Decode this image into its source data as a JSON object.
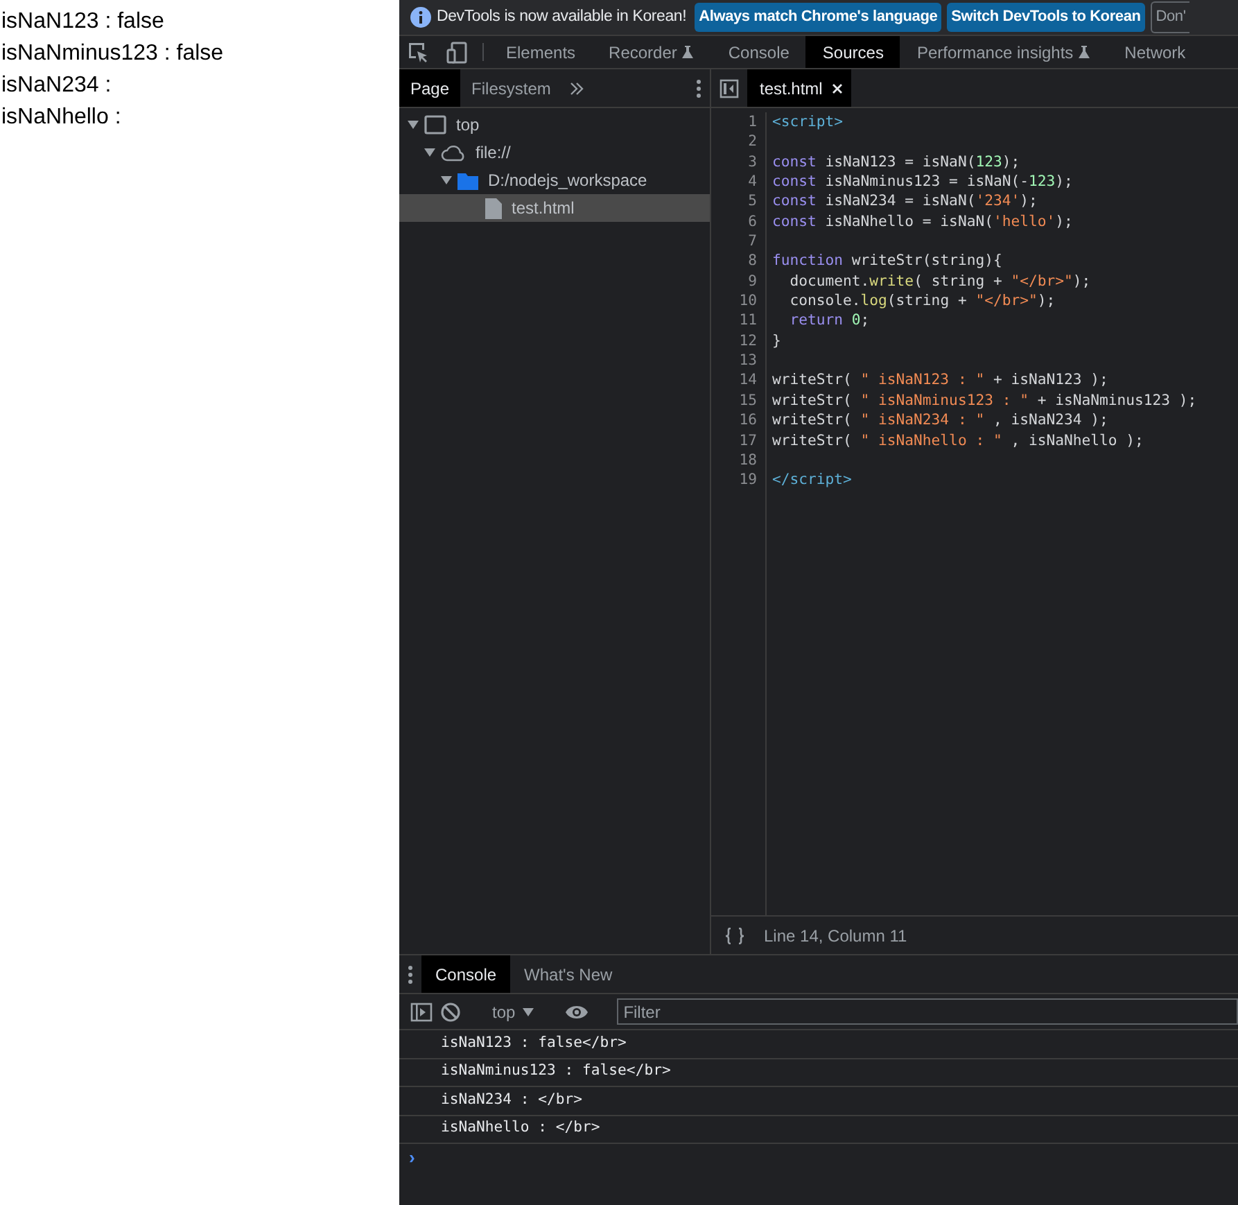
{
  "page_output": [
    "isNaN123 : false",
    "isNaNminus123 : false",
    "isNaN234 :",
    "isNaNhello :"
  ],
  "infobar": {
    "message": "DevTools is now available in Korean!",
    "buttons": [
      {
        "label": "Always match Chrome's language",
        "kind": "primary"
      },
      {
        "label": "Switch DevTools to Korean",
        "kind": "primary"
      },
      {
        "label": "Don'",
        "kind": "outline"
      }
    ]
  },
  "main_tabs": [
    {
      "label": "Elements",
      "selected": false,
      "experimental": false
    },
    {
      "label": "Recorder",
      "selected": false,
      "experimental": true
    },
    {
      "label": "Console",
      "selected": false,
      "experimental": false
    },
    {
      "label": "Sources",
      "selected": true,
      "experimental": false
    },
    {
      "label": "Performance insights",
      "selected": false,
      "experimental": true
    },
    {
      "label": "Network",
      "selected": false,
      "experimental": false
    }
  ],
  "navigator": {
    "tabs": [
      {
        "label": "Page",
        "selected": true
      },
      {
        "label": "Filesystem",
        "selected": false
      }
    ],
    "tree": [
      {
        "label": "top",
        "kind": "frame",
        "selected": false,
        "expanded": true,
        "children": [
          {
            "label": "file://",
            "kind": "origin",
            "selected": false,
            "expanded": true,
            "children": [
              {
                "label": "D:/nodejs_workspace",
                "kind": "folder",
                "selected": false,
                "expanded": true,
                "children": [
                  {
                    "label": "test.html",
                    "kind": "file",
                    "selected": true
                  }
                ]
              }
            ]
          }
        ]
      }
    ]
  },
  "editor": {
    "tabs": [
      {
        "label": "test.html",
        "selected": true
      }
    ],
    "lines": [
      {
        "number": "1",
        "tokens": [
          {
            "kind": "tag",
            "text": "<script>"
          }
        ]
      },
      {
        "number": "2"
      },
      {
        "number": "3",
        "tokens": [
          {
            "kind": "keyword",
            "text": "const"
          },
          {
            "kind": "plain",
            "text": " isNaN123 = isNaN("
          },
          {
            "kind": "number",
            "text": "123"
          },
          {
            "kind": "plain",
            "text": ");"
          }
        ]
      },
      {
        "number": "4",
        "tokens": [
          {
            "kind": "keyword",
            "text": "const"
          },
          {
            "kind": "plain",
            "text": " isNaNminus123 = isNaN(-"
          },
          {
            "kind": "number",
            "text": "123"
          },
          {
            "kind": "plain",
            "text": ");"
          }
        ]
      },
      {
        "number": "5",
        "tokens": [
          {
            "kind": "keyword",
            "text": "const"
          },
          {
            "kind": "plain",
            "text": " isNaN234 = isNaN("
          },
          {
            "kind": "string",
            "text": "'234'"
          },
          {
            "kind": "plain",
            "text": ");"
          }
        ]
      },
      {
        "number": "6",
        "tokens": [
          {
            "kind": "keyword",
            "text": "const"
          },
          {
            "kind": "plain",
            "text": " isNaNhello = isNaN("
          },
          {
            "kind": "string",
            "text": "'hello'"
          },
          {
            "kind": "plain",
            "text": ");"
          }
        ]
      },
      {
        "number": "7"
      },
      {
        "number": "8",
        "tokens": [
          {
            "kind": "keyword",
            "text": "function"
          },
          {
            "kind": "plain",
            "text": " writeStr(string){"
          }
        ]
      },
      {
        "number": "9",
        "tokens": [
          {
            "kind": "plain",
            "text": "  document."
          },
          {
            "kind": "method",
            "text": "write"
          },
          {
            "kind": "plain",
            "text": "( string + "
          },
          {
            "kind": "string",
            "text": "\"</br>\""
          },
          {
            "kind": "plain",
            "text": ");"
          }
        ]
      },
      {
        "number": "10",
        "tokens": [
          {
            "kind": "plain",
            "text": "  console."
          },
          {
            "kind": "method",
            "text": "log"
          },
          {
            "kind": "plain",
            "text": "(string + "
          },
          {
            "kind": "string",
            "text": "\"</br>\""
          },
          {
            "kind": "plain",
            "text": ");"
          }
        ]
      },
      {
        "number": "11",
        "tokens": [
          {
            "kind": "keyword",
            "text": "  return"
          },
          {
            "kind": "number",
            "text": " 0"
          },
          {
            "kind": "plain",
            "text": ";"
          }
        ]
      },
      {
        "number": "12",
        "tokens": [
          {
            "kind": "plain",
            "text": "}"
          }
        ]
      },
      {
        "number": "13"
      },
      {
        "number": "14",
        "tokens": [
          {
            "kind": "plain",
            "text": "writeStr( "
          },
          {
            "kind": "string",
            "text": "\" isNaN123 : \""
          },
          {
            "kind": "plain",
            "text": " + isNaN123 );"
          }
        ]
      },
      {
        "number": "15",
        "tokens": [
          {
            "kind": "plain",
            "text": "writeStr( "
          },
          {
            "kind": "string",
            "text": "\" isNaNminus123 : \""
          },
          {
            "kind": "plain",
            "text": " + isNaNminus123 );"
          }
        ]
      },
      {
        "number": "16",
        "tokens": [
          {
            "kind": "plain",
            "text": "writeStr( "
          },
          {
            "kind": "string",
            "text": "\" isNaN234 : \""
          },
          {
            "kind": "plain",
            "text": " , isNaN234 );"
          }
        ]
      },
      {
        "number": "17",
        "tokens": [
          {
            "kind": "plain",
            "text": "writeStr( "
          },
          {
            "kind": "string",
            "text": "\" isNaNhello : \""
          },
          {
            "kind": "plain",
            "text": " , isNaNhello );"
          }
        ]
      },
      {
        "number": "18"
      },
      {
        "number": "19",
        "tokens": [
          {
            "kind": "tag",
            "text": "</script>"
          }
        ]
      }
    ],
    "status": "Line 14, Column 11"
  },
  "drawer": {
    "tabs": [
      {
        "label": "Console",
        "selected": true
      },
      {
        "label": "What's New",
        "selected": false
      }
    ],
    "context": "top",
    "filter": {
      "placeholder": "Filter"
    },
    "messages": [
      "isNaN123 : false</br>",
      "isNaNminus123 : false</br>",
      "isNaN234 : </br>",
      "isNaNhello : </br>"
    ],
    "prompt": "›"
  }
}
